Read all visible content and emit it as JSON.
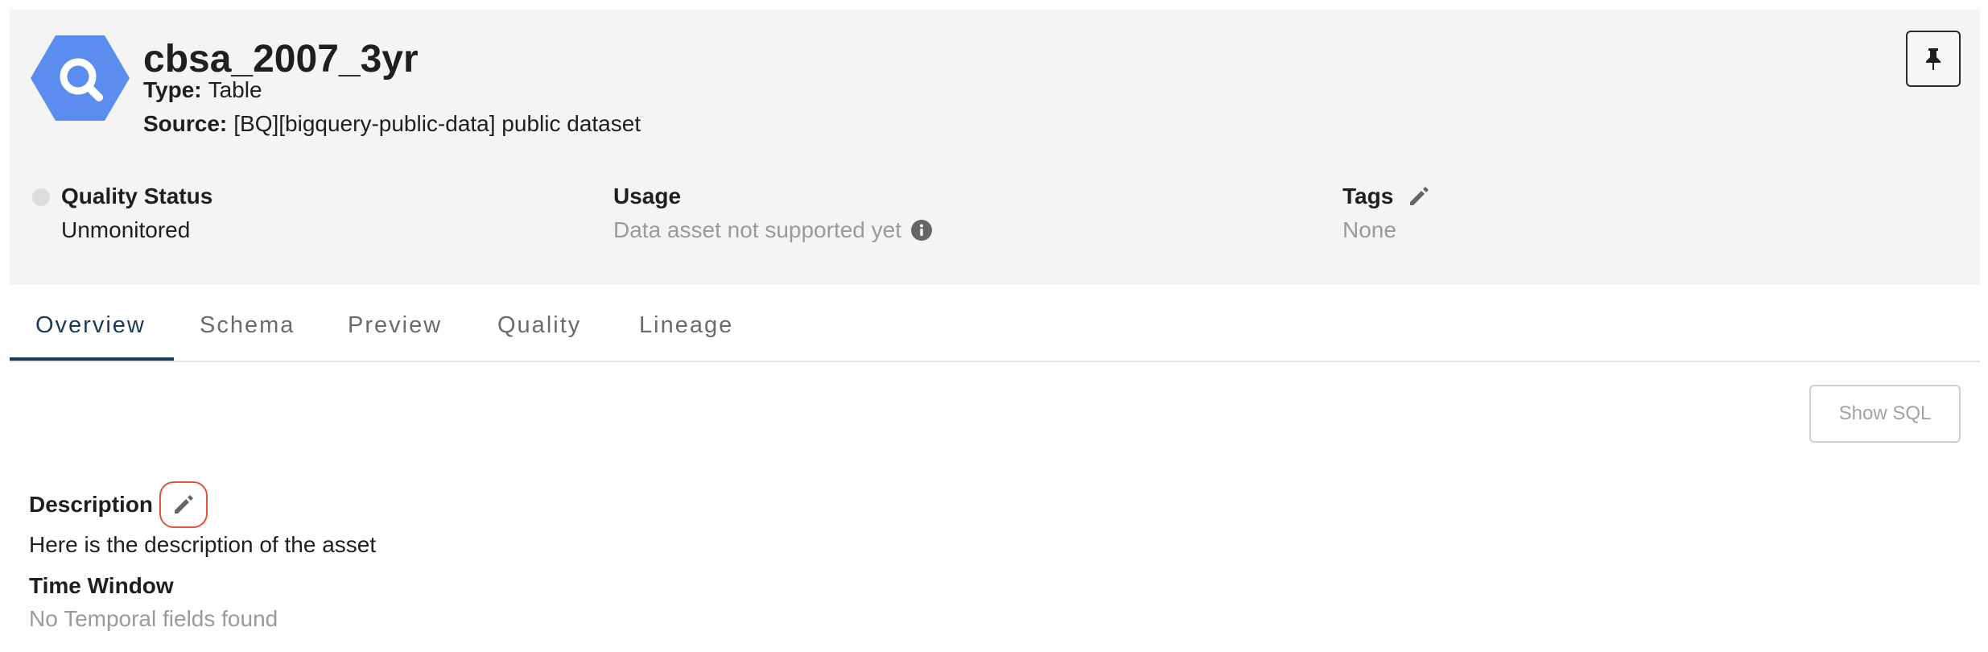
{
  "asset": {
    "title": "cbsa_2007_3yr",
    "type_key": "Type:",
    "type_value": "Table",
    "source_key": "Source:",
    "source_value": "[BQ][bigquery-public-data] public dataset"
  },
  "stats": {
    "quality_label": "Quality Status",
    "quality_value": "Unmonitored",
    "usage_label": "Usage",
    "usage_value": "Data asset not supported yet",
    "tags_label": "Tags",
    "tags_value": "None"
  },
  "tabs": [
    {
      "label": "Overview",
      "active": true
    },
    {
      "label": "Schema",
      "active": false
    },
    {
      "label": "Preview",
      "active": false
    },
    {
      "label": "Quality",
      "active": false
    },
    {
      "label": "Lineage",
      "active": false
    }
  ],
  "actions": {
    "show_sql_label": "Show SQL"
  },
  "overview": {
    "description_label": "Description",
    "description_text": "Here is the description of the asset",
    "time_window_label": "Time Window",
    "time_window_text": "No Temporal fields found"
  },
  "icons": {
    "logo": "bigquery-search-icon",
    "pin": "pin-icon",
    "info": "info-icon",
    "edit": "pencil-icon"
  },
  "colors": {
    "header_bg": "#f4f4f4",
    "logo_blue": "#5b8def",
    "tab_active": "#1b3a5a",
    "edit_focus_ring": "#e0533c"
  }
}
